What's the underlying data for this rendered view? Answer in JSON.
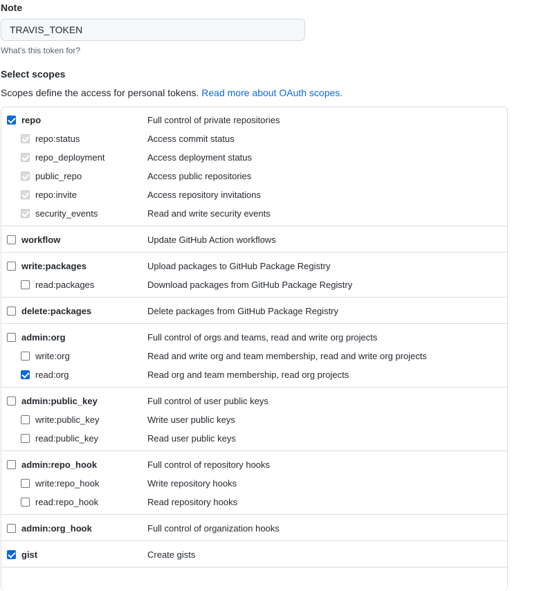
{
  "note": {
    "label": "Note",
    "value": "TRAVIS_TOKEN",
    "hint": "What's this token for?"
  },
  "scopes": {
    "title": "Select scopes",
    "description": "Scopes define the access for personal tokens. ",
    "link_text": "Read more about OAuth scopes.",
    "groups": [
      {
        "name": "repo",
        "description": "Full control of private repositories",
        "checked": true,
        "children": [
          {
            "name": "repo:status",
            "description": "Access commit status",
            "checked": true,
            "disabled": true
          },
          {
            "name": "repo_deployment",
            "description": "Access deployment status",
            "checked": true,
            "disabled": true
          },
          {
            "name": "public_repo",
            "description": "Access public repositories",
            "checked": true,
            "disabled": true
          },
          {
            "name": "repo:invite",
            "description": "Access repository invitations",
            "checked": true,
            "disabled": true
          },
          {
            "name": "security_events",
            "description": "Read and write security events",
            "checked": true,
            "disabled": true
          }
        ]
      },
      {
        "name": "workflow",
        "description": "Update GitHub Action workflows",
        "checked": false,
        "children": []
      },
      {
        "name": "write:packages",
        "description": "Upload packages to GitHub Package Registry",
        "checked": false,
        "children": [
          {
            "name": "read:packages",
            "description": "Download packages from GitHub Package Registry",
            "checked": false
          }
        ]
      },
      {
        "name": "delete:packages",
        "description": "Delete packages from GitHub Package Registry",
        "checked": false,
        "children": []
      },
      {
        "name": "admin:org",
        "description": "Full control of orgs and teams, read and write org projects",
        "checked": false,
        "children": [
          {
            "name": "write:org",
            "description": "Read and write org and team membership, read and write org projects",
            "checked": false
          },
          {
            "name": "read:org",
            "description": "Read org and team membership, read org projects",
            "checked": true
          }
        ]
      },
      {
        "name": "admin:public_key",
        "description": "Full control of user public keys",
        "checked": false,
        "children": [
          {
            "name": "write:public_key",
            "description": "Write user public keys",
            "checked": false
          },
          {
            "name": "read:public_key",
            "description": "Read user public keys",
            "checked": false
          }
        ]
      },
      {
        "name": "admin:repo_hook",
        "description": "Full control of repository hooks",
        "checked": false,
        "children": [
          {
            "name": "write:repo_hook",
            "description": "Write repository hooks",
            "checked": false
          },
          {
            "name": "read:repo_hook",
            "description": "Read repository hooks",
            "checked": false
          }
        ]
      },
      {
        "name": "admin:org_hook",
        "description": "Full control of organization hooks",
        "checked": false,
        "children": []
      },
      {
        "name": "gist",
        "description": "Create gists",
        "checked": true,
        "children": []
      }
    ]
  }
}
